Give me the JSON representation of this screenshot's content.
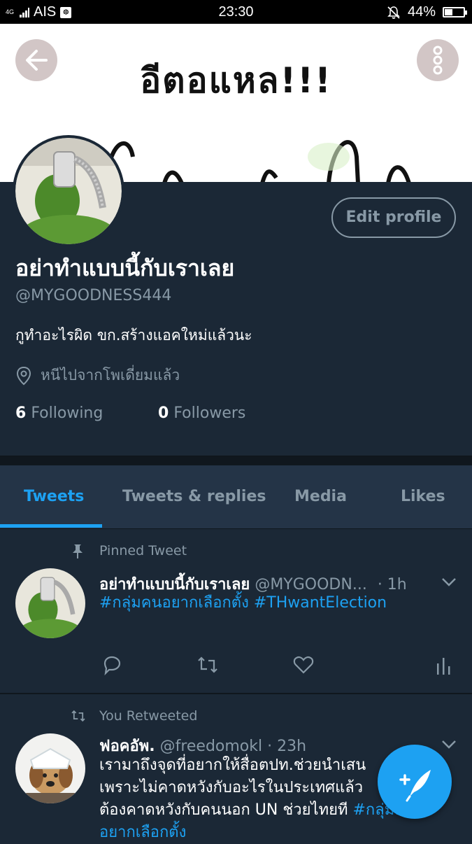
{
  "status_bar": {
    "signal_label": "4G",
    "carrier": "AIS",
    "time": "23:30",
    "battery_text": "44%",
    "battery_level": 0.44,
    "icons": [
      "signal-icon",
      "carrier-app-icon",
      "mute-bell-icon",
      "battery-icon"
    ]
  },
  "banner": {
    "text": "อีตอแหล!!!",
    "icons": [
      "back-arrow-icon",
      "more-options-icon"
    ]
  },
  "profile": {
    "edit_label": "Edit profile",
    "display_name": "อย่าทำแบบนี้กับเราเลย",
    "handle": "@MYGOODNESS444",
    "bio": "กูทำอะไรผิด ขก.สร้างแอคใหม่แล้วนะ",
    "location": "หนีไปจากโพเดี่ยมแล้ว",
    "following_count": "6",
    "following_label": "Following",
    "followers_count": "0",
    "followers_label": "Followers"
  },
  "tabs": [
    {
      "label": "Tweets",
      "active": true
    },
    {
      "label": "Tweets & replies",
      "active": false
    },
    {
      "label": "Media",
      "active": false
    },
    {
      "label": "Likes",
      "active": false
    }
  ],
  "tweets": [
    {
      "meta": "Pinned Tweet",
      "name": "อย่าทำแบบนี้กับเราเลย",
      "handle": "@MYGOODN...",
      "time": "· 1h",
      "hashtag1": "#กลุ่มคนอยากเลือกตั้ง",
      "hashtag2": "#THwantElection"
    },
    {
      "meta": "You Retweeted",
      "name": "ฟอคอัพ.",
      "handle": "@freedomokl",
      "time": "· 23h",
      "line1": "เรามาถึงจุดที่อยากให้สื่อตปท.ช่วยนำเสน",
      "line2": "เพราะไม่คาดหวังกับอะไรในประเทศแล้ว",
      "line3": "ต้องคาดหวังกับคนนอก UN ช่วยไทยที",
      "hashtag": "#กลุ่มคน",
      "line4": "อยากเลือกตั้ง"
    }
  ],
  "colors": {
    "background": "#1b2836",
    "tab_bar": "#243447",
    "accent": "#1da1f2",
    "muted": "#8899a6"
  }
}
